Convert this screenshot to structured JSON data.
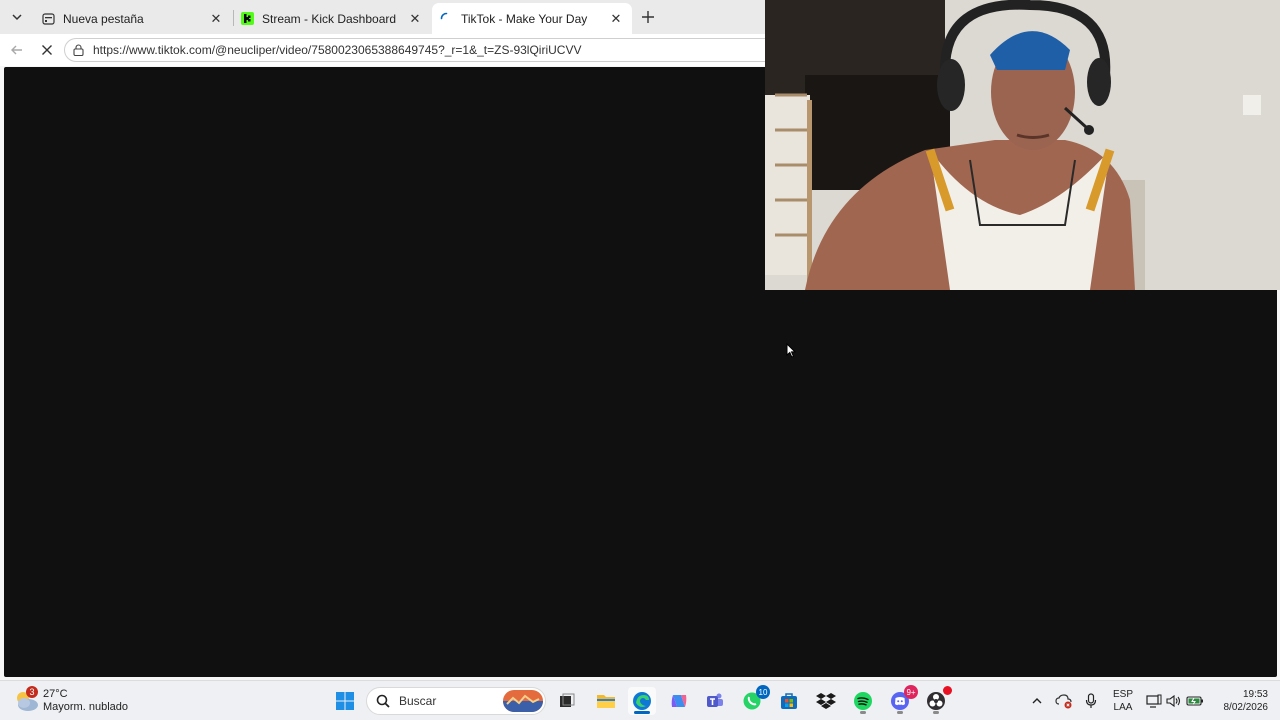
{
  "browser": {
    "tabs": [
      {
        "title": "Nueva pestaña",
        "active": false,
        "favicon": "calendar-icon"
      },
      {
        "title": "Stream - Kick Dashboard",
        "active": false,
        "favicon": "kick-logo-icon"
      },
      {
        "title": "TikTok - Make Your Day",
        "active": true,
        "favicon": "loading-spinner-icon"
      }
    ],
    "address_url": "https://www.tiktok.com/@neucliper/video/7580023065388649745?_r=1&_t=ZS-93lQiriUCVV",
    "loading": true
  },
  "taskbar": {
    "weather": {
      "badge": "3",
      "temp": "27°C",
      "condition": "Mayorm. nublado"
    },
    "search_placeholder": "Buscar",
    "apps": [
      {
        "name": "windows-start-icon"
      },
      {
        "name": "task-view-icon"
      },
      {
        "name": "file-explorer-icon"
      },
      {
        "name": "edge-icon",
        "active": true
      },
      {
        "name": "copilot-icon"
      },
      {
        "name": "teams-icon"
      },
      {
        "name": "whatsapp-icon",
        "badge": "10"
      },
      {
        "name": "microsoft-store-icon"
      },
      {
        "name": "dropbox-icon"
      },
      {
        "name": "spotify-icon"
      },
      {
        "name": "discord-icon",
        "badge": "9+"
      },
      {
        "name": "obs-icon"
      }
    ],
    "language": {
      "line1": "ESP",
      "line2": "LAA"
    },
    "time": "19:53",
    "date": "8/02/2026"
  },
  "colors": {
    "page_background": "#101010",
    "accent": "#0067c0",
    "kick_green": "#53fc18",
    "badge_red": "#c42b1c"
  }
}
